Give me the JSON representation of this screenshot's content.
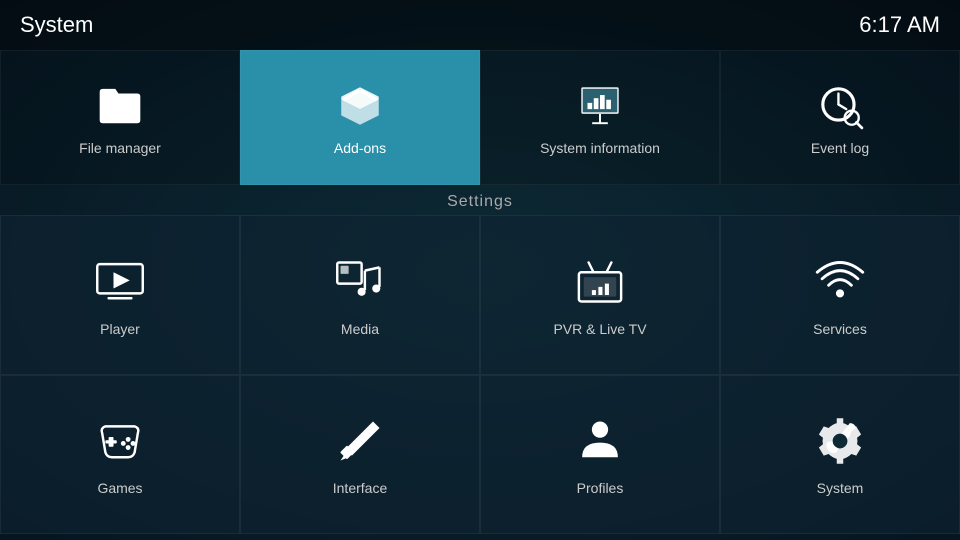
{
  "topbar": {
    "title": "System",
    "clock": "6:17 AM"
  },
  "topMenu": {
    "items": [
      {
        "id": "file-manager",
        "label": "File manager",
        "active": false
      },
      {
        "id": "add-ons",
        "label": "Add-ons",
        "active": true
      },
      {
        "id": "system-information",
        "label": "System information",
        "active": false
      },
      {
        "id": "event-log",
        "label": "Event log",
        "active": false
      }
    ]
  },
  "settings": {
    "title": "Settings"
  },
  "grid": {
    "items": [
      {
        "id": "player",
        "label": "Player"
      },
      {
        "id": "media",
        "label": "Media"
      },
      {
        "id": "pvr-live-tv",
        "label": "PVR & Live TV"
      },
      {
        "id": "services",
        "label": "Services"
      },
      {
        "id": "games",
        "label": "Games"
      },
      {
        "id": "interface",
        "label": "Interface"
      },
      {
        "id": "profiles",
        "label": "Profiles"
      },
      {
        "id": "system",
        "label": "System"
      }
    ]
  }
}
